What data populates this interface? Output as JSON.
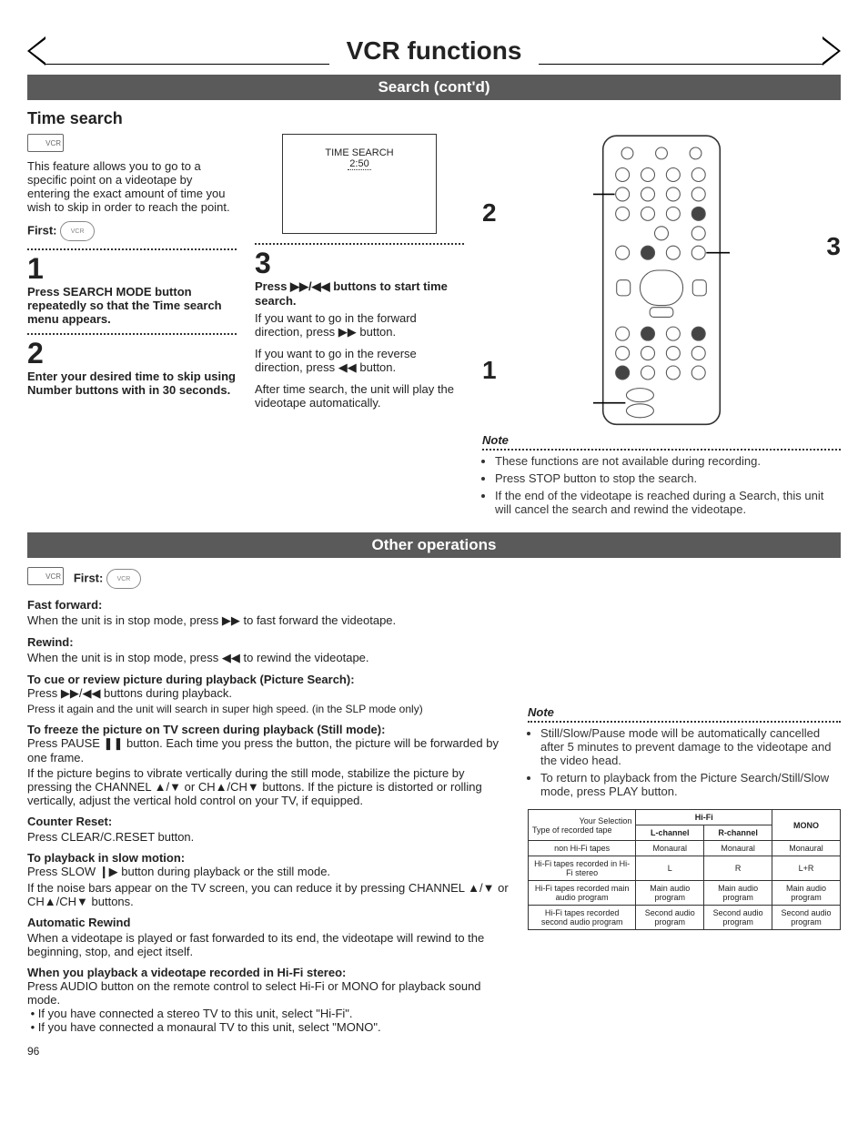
{
  "page": {
    "title": "VCR functions",
    "section1": "Search (cont'd)",
    "section2": "Other operations",
    "footer": "96"
  },
  "timesearch": {
    "heading": "Time search",
    "vcr_tag": "VCR",
    "intro": "This feature allows you to go to a specific point on a videotape by entering the exact amount of time you wish to skip in order to reach the point.",
    "first_label": "First:",
    "step1": {
      "num": "1",
      "title": "Press SEARCH MODE button repeatedly so that the Time search menu appears."
    },
    "step2": {
      "num": "2",
      "title": "Enter your desired time to skip using Number buttons with in 30 seconds."
    },
    "screen": {
      "label": "TIME SEARCH",
      "value": "2:50"
    },
    "step3": {
      "num": "3",
      "title": "Press ▶▶/◀◀ buttons to start time search.",
      "body1": "If you want to go in the forward direction, press ▶▶ button.",
      "body2": "If you want to go in the reverse direction, press ◀◀ button.",
      "body3": "After time search, the unit will play the videotape automatically."
    },
    "callouts": {
      "c1": "1",
      "c2": "2",
      "c3": "3"
    },
    "note": {
      "title": "Note",
      "items": [
        "These functions are not available during recording.",
        "Press STOP button to stop the search.",
        "If the end of the videotape is reached during a Search, this unit will cancel the search and rewind the videotape."
      ]
    }
  },
  "other": {
    "vcr_tag": "VCR",
    "first_label": "First:",
    "ff": {
      "title": "Fast forward:",
      "body": "When the unit is in stop mode, press ▶▶ to fast forward the videotape."
    },
    "rw": {
      "title": "Rewind:",
      "body": "When the unit is in stop mode, press ◀◀ to rewind the videotape."
    },
    "cue": {
      "title": "To cue or review picture during playback (Picture Search):",
      "body1": "Press ▶▶/◀◀ buttons during playback.",
      "body2": "Press it again and the unit will search in super high speed. (in the SLP mode only)"
    },
    "freeze": {
      "title": "To freeze the picture on TV screen during playback (Still mode):",
      "body1": "Press PAUSE ❚❚ button. Each time you press the button, the picture will be forwarded by one frame.",
      "body2": "If the picture begins to vibrate vertically during the still mode, stabilize the picture by pressing the CHANNEL ▲/▼ or CH▲/CH▼ buttons. If the picture is distorted or rolling vertically, adjust the vertical hold control on your TV, if equipped."
    },
    "counter": {
      "title": "Counter Reset:",
      "body": "Press CLEAR/C.RESET button."
    },
    "slow": {
      "title": "To playback in slow motion:",
      "body1": "Press SLOW ❙▶ button during playback or the still mode.",
      "body2": "If the noise bars appear on the TV screen, you can reduce it by pressing CHANNEL ▲/▼ or CH▲/CH▼ buttons."
    },
    "autorw": {
      "title": "Automatic Rewind",
      "body": "When a videotape is played or fast forwarded to its end, the videotape will rewind to the beginning, stop, and eject itself."
    },
    "hifi": {
      "title": "When you playback a videotape recorded in Hi-Fi stereo:",
      "body1": "Press AUDIO button on the remote control to select Hi-Fi or MONO for playback sound mode.",
      "bul1": "If you have connected a stereo TV to this unit, select \"Hi-Fi\".",
      "bul2": "If you have connected a monaural TV to this unit, select \"MONO\"."
    },
    "note": {
      "title": "Note",
      "items": [
        "Still/Slow/Pause mode will be automatically cancelled after 5 minutes to prevent damage to the videotape and the video head.",
        "To return to playback from the Picture Search/Still/Slow mode, press PLAY button."
      ]
    },
    "table": {
      "h_sel": "Your Selection",
      "h_hifi": "Hi-Fi",
      "h_mono": "MONO",
      "h_type": "Type of recorded tape",
      "h_l": "L-channel",
      "h_r": "R-channel",
      "r1": {
        "c0": "non Hi-Fi tapes",
        "c1": "Monaural",
        "c2": "Monaural",
        "c3": "Monaural"
      },
      "r2": {
        "c0": "Hi-Fi tapes recorded in Hi-Fi stereo",
        "c1": "L",
        "c2": "R",
        "c3": "L+R"
      },
      "r3": {
        "c0": "Hi-Fi tapes recorded main audio program",
        "c1": "Main audio program",
        "c2": "Main audio program",
        "c3": "Main audio program"
      },
      "r4": {
        "c0": "Hi-Fi tapes recorded second audio program",
        "c1": "Second audio program",
        "c2": "Second audio program",
        "c3": "Second audio program"
      }
    }
  }
}
